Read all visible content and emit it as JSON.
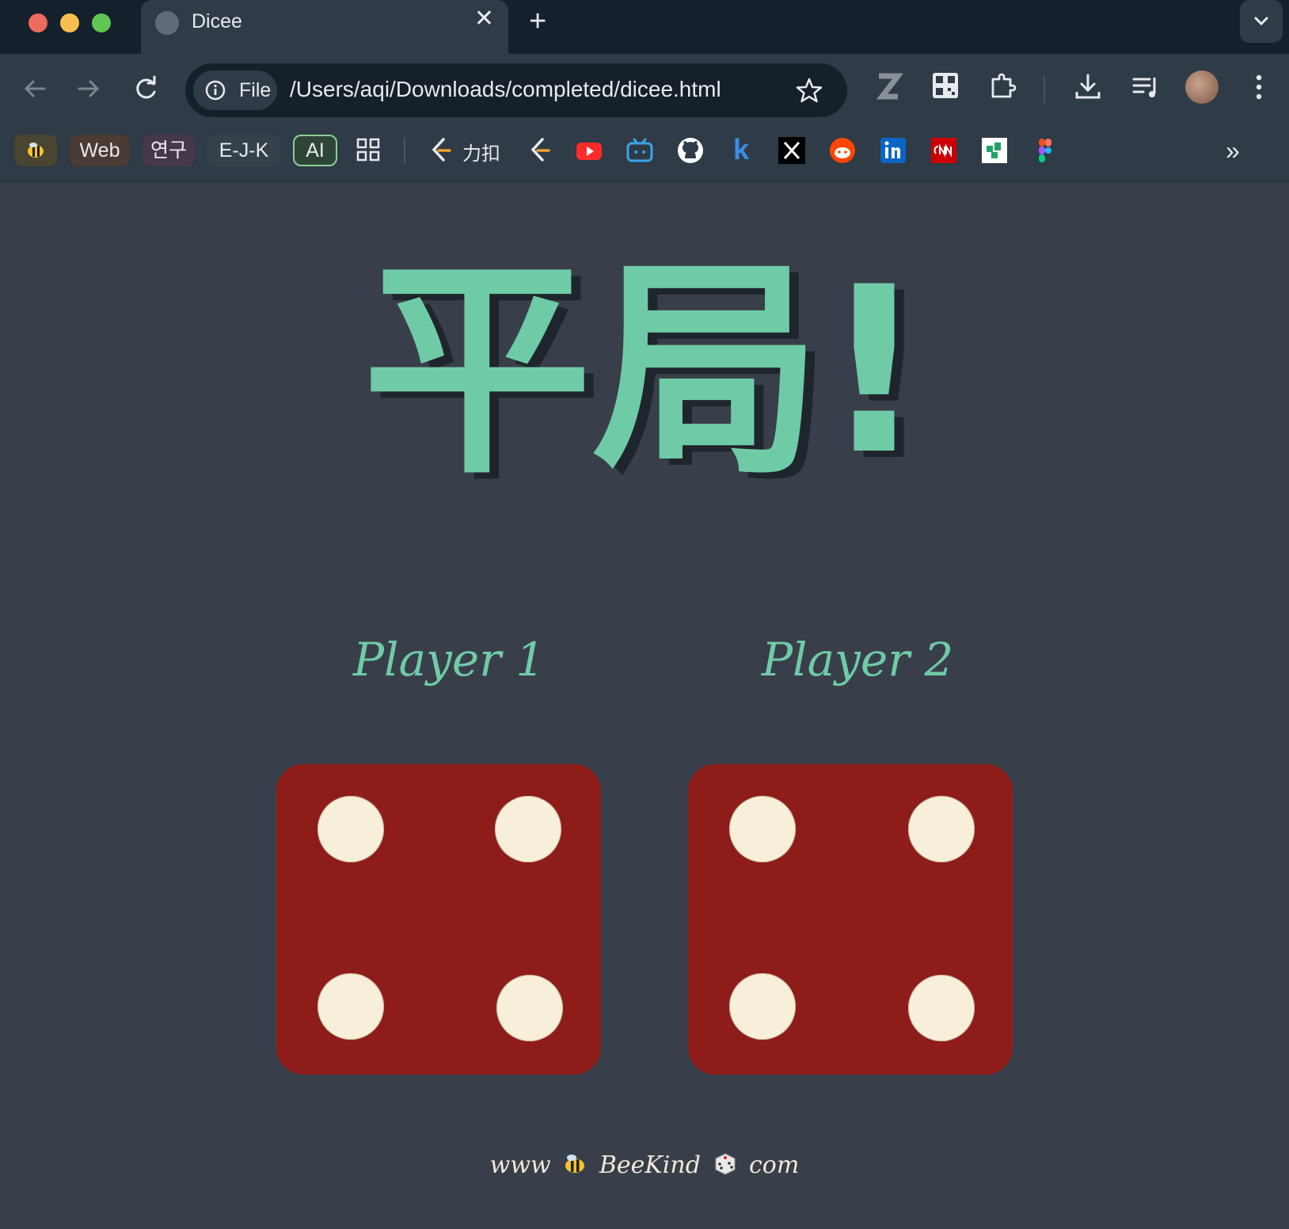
{
  "browser": {
    "tab": {
      "title": "Dicee"
    },
    "omnibox": {
      "chip_label": "File",
      "url": "/Users/aqi/Downloads/completed/dicee.html"
    },
    "extensions": [
      "z-extension-icon",
      "qr-code-icon",
      "puzzle-icon",
      "download-icon",
      "media-queue-icon"
    ],
    "bookmarks": {
      "web": "Web",
      "research": "연구",
      "ejk": "E-J-K",
      "ai": "AI",
      "juejin": "力扣"
    }
  },
  "page": {
    "headline": "平局!",
    "players": [
      {
        "label": "Player 1",
        "die_value": 4
      },
      {
        "label": "Player 2",
        "die_value": 4
      }
    ],
    "footer": {
      "prefix": "www",
      "brand": "BeeKind",
      "suffix": "com"
    }
  },
  "colors": {
    "accent": "#6fcba6",
    "background": "#393f4a",
    "die_face": "#8e1d1a",
    "pip": "#f7efd9"
  }
}
